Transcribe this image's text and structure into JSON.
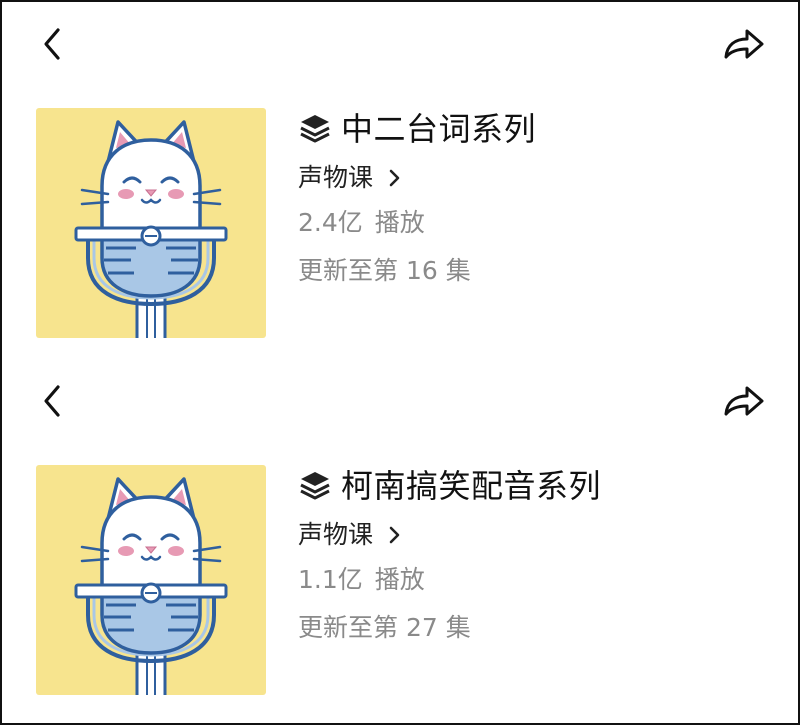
{
  "panels": [
    {
      "title": "中二台词系列",
      "author": "声物课",
      "plays_value": "2.4亿",
      "plays_unit": "播放",
      "update_text": "更新至第 16 集",
      "icons": {
        "back": "chevron-left-icon",
        "share": "share-arrow-icon",
        "series": "layers-stack-icon",
        "author_arrow": "chevron-right-icon",
        "cover": "cat-microphone-illustration"
      }
    },
    {
      "title": "柯南搞笑配音系列",
      "author": "声物课",
      "plays_value": "1.1亿",
      "plays_unit": "播放",
      "update_text": "更新至第 27 集",
      "icons": {
        "back": "chevron-left-icon",
        "share": "share-arrow-icon",
        "series": "layers-stack-icon",
        "author_arrow": "chevron-right-icon",
        "cover": "cat-microphone-illustration"
      }
    }
  ],
  "colors": {
    "cover_background": "#f7e48e",
    "mic_blue": "#2f5f9e",
    "mic_light_blue": "#a9c7e6",
    "title_text": "#111111",
    "meta_text": "#8a8a8a"
  }
}
